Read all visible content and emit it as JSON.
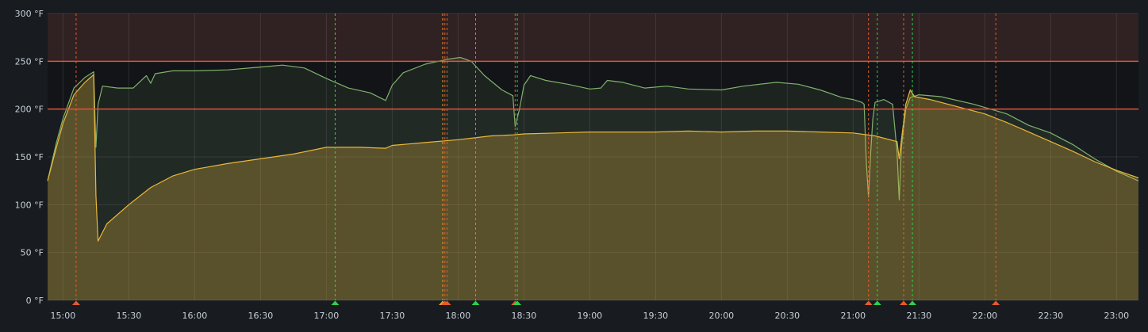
{
  "chart_data": {
    "type": "area",
    "y_unit": "°F",
    "ylim": [
      0,
      300
    ],
    "yticks": [
      0,
      50,
      100,
      150,
      200,
      250,
      300
    ],
    "ytick_labels": [
      "0 °F",
      "50 °F",
      "100 °F",
      "150 °F",
      "200 °F",
      "250 °F",
      "300 °F"
    ],
    "xlim": [
      "14:53",
      "23:10"
    ],
    "xticks": [
      "15:00",
      "15:30",
      "16:00",
      "16:30",
      "17:00",
      "17:30",
      "18:00",
      "18:30",
      "19:00",
      "19:30",
      "20:00",
      "20:30",
      "21:00",
      "21:30",
      "22:00",
      "22:30",
      "23:00"
    ],
    "grid": true,
    "thresholds": [
      {
        "value": 250,
        "color": "#e0523a",
        "band": "above",
        "band_color": "rgba(224,82,58,0.12)"
      },
      {
        "value": 200,
        "color": "#e0523a",
        "band": "between",
        "band_color": "rgba(0,0,0,0.25)"
      }
    ],
    "series": [
      {
        "color": "#7eb26d",
        "fill": "rgba(126,178,109,0.10)",
        "points": [
          [
            "14:53",
            125
          ],
          [
            "14:57",
            165
          ],
          [
            "15:00",
            190
          ],
          [
            "15:05",
            222
          ],
          [
            "15:10",
            233
          ],
          [
            "15:14",
            239
          ],
          [
            "15:15",
            160
          ],
          [
            "15:16",
            205
          ],
          [
            "15:18",
            224
          ],
          [
            "15:25",
            222
          ],
          [
            "15:32",
            222
          ],
          [
            "15:38",
            235
          ],
          [
            "15:40",
            227
          ],
          [
            "15:42",
            237
          ],
          [
            "15:50",
            240
          ],
          [
            "16:00",
            240
          ],
          [
            "16:15",
            241
          ],
          [
            "16:30",
            244
          ],
          [
            "16:40",
            246
          ],
          [
            "16:50",
            243
          ],
          [
            "17:00",
            232
          ],
          [
            "17:10",
            222
          ],
          [
            "17:20",
            217
          ],
          [
            "17:27",
            209
          ],
          [
            "17:30",
            225
          ],
          [
            "17:35",
            238
          ],
          [
            "17:45",
            247
          ],
          [
            "17:55",
            252
          ],
          [
            "18:01",
            254
          ],
          [
            "18:06",
            250
          ],
          [
            "18:12",
            235
          ],
          [
            "18:20",
            220
          ],
          [
            "18:25",
            214
          ],
          [
            "18:26",
            182
          ],
          [
            "18:28",
            200
          ],
          [
            "18:30",
            225
          ],
          [
            "18:33",
            235
          ],
          [
            "18:40",
            230
          ],
          [
            "18:50",
            226
          ],
          [
            "19:00",
            221
          ],
          [
            "19:05",
            222
          ],
          [
            "19:08",
            230
          ],
          [
            "19:15",
            228
          ],
          [
            "19:25",
            222
          ],
          [
            "19:35",
            224
          ],
          [
            "19:45",
            221
          ],
          [
            "20:00",
            220
          ],
          [
            "20:10",
            224
          ],
          [
            "20:25",
            228
          ],
          [
            "20:35",
            226
          ],
          [
            "20:45",
            220
          ],
          [
            "20:55",
            212
          ],
          [
            "21:00",
            210
          ],
          [
            "21:04",
            207
          ],
          [
            "21:05",
            205
          ],
          [
            "21:06",
            145
          ],
          [
            "21:07",
            108
          ],
          [
            "21:08",
            155
          ],
          [
            "21:09",
            190
          ],
          [
            "21:10",
            207
          ],
          [
            "21:14",
            210
          ],
          [
            "21:18",
            205
          ],
          [
            "21:20",
            155
          ],
          [
            "21:21",
            105
          ],
          [
            "21:22",
            160
          ],
          [
            "21:24",
            200
          ],
          [
            "21:26",
            212
          ],
          [
            "21:30",
            215
          ],
          [
            "21:40",
            213
          ],
          [
            "21:55",
            205
          ],
          [
            "22:10",
            195
          ],
          [
            "22:20",
            183
          ],
          [
            "22:30",
            175
          ],
          [
            "22:40",
            163
          ],
          [
            "22:50",
            148
          ],
          [
            "23:00",
            135
          ],
          [
            "23:10",
            125
          ]
        ]
      },
      {
        "color": "#eab839",
        "fill": "rgba(234,184,57,0.28)",
        "points": [
          [
            "14:53",
            125
          ],
          [
            "14:57",
            160
          ],
          [
            "15:00",
            185
          ],
          [
            "15:05",
            215
          ],
          [
            "15:10",
            228
          ],
          [
            "15:14",
            236
          ],
          [
            "15:15",
            110
          ],
          [
            "15:16",
            62
          ],
          [
            "15:20",
            80
          ],
          [
            "15:30",
            100
          ],
          [
            "15:40",
            118
          ],
          [
            "15:50",
            130
          ],
          [
            "16:00",
            137
          ],
          [
            "16:15",
            143
          ],
          [
            "16:30",
            148
          ],
          [
            "16:45",
            153
          ],
          [
            "17:00",
            160
          ],
          [
            "17:15",
            160
          ],
          [
            "17:27",
            159
          ],
          [
            "17:30",
            162
          ],
          [
            "17:45",
            165
          ],
          [
            "18:00",
            168
          ],
          [
            "18:15",
            172
          ],
          [
            "18:25",
            173
          ],
          [
            "18:30",
            174
          ],
          [
            "18:45",
            175
          ],
          [
            "19:00",
            176
          ],
          [
            "19:15",
            176
          ],
          [
            "19:30",
            176
          ],
          [
            "19:45",
            177
          ],
          [
            "20:00",
            176
          ],
          [
            "20:15",
            177
          ],
          [
            "20:30",
            177
          ],
          [
            "20:45",
            176
          ],
          [
            "21:00",
            175
          ],
          [
            "21:10",
            172
          ],
          [
            "21:20",
            166
          ],
          [
            "21:21",
            148
          ],
          [
            "21:22",
            168
          ],
          [
            "21:24",
            205
          ],
          [
            "21:26",
            220
          ],
          [
            "21:28",
            213
          ],
          [
            "21:35",
            210
          ],
          [
            "21:45",
            204
          ],
          [
            "22:00",
            195
          ],
          [
            "22:10",
            186
          ],
          [
            "22:20",
            176
          ],
          [
            "22:30",
            166
          ],
          [
            "22:40",
            156
          ],
          [
            "22:50",
            145
          ],
          [
            "23:00",
            136
          ],
          [
            "23:10",
            128
          ]
        ]
      }
    ],
    "annotations": [
      {
        "time": "15:06",
        "color": "#e55b2c",
        "marker": "triangle"
      },
      {
        "time": "17:04",
        "color": "#2fd04c",
        "marker": "triangle"
      },
      {
        "time": "17:53",
        "color": "#e0a030",
        "marker": "triangle"
      },
      {
        "time": "17:54",
        "color": "#e55b2c",
        "marker": "triangle"
      },
      {
        "time": "17:55",
        "color": "#e55b2c",
        "marker": "triangle"
      },
      {
        "time": "18:08",
        "color": "#2fd04c",
        "marker": "triangle"
      },
      {
        "time": "18:26",
        "color": "#e55b2c",
        "marker": "triangle"
      },
      {
        "time": "18:27",
        "color": "#2fd04c",
        "marker": "triangle"
      },
      {
        "time": "21:07",
        "color": "#e55b2c",
        "marker": "triangle"
      },
      {
        "time": "21:11",
        "color": "#2fd04c",
        "marker": "triangle"
      },
      {
        "time": "21:23",
        "color": "#e55b2c",
        "marker": "triangle"
      },
      {
        "time": "21:27",
        "color": "#2fd04c",
        "marker": "triangle"
      },
      {
        "time": "22:05",
        "color": "#e55b2c",
        "marker": "triangle"
      }
    ]
  }
}
